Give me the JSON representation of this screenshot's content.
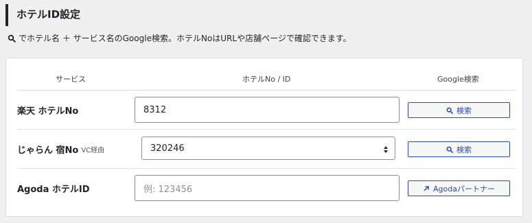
{
  "section": {
    "title": "ホテルID設定"
  },
  "hint": {
    "icon": "search-icon",
    "text": "でホテル名 ＋ サービス名のGoogle検索。ホテルNoはURLや店舗ページで確認できます。"
  },
  "table": {
    "headers": {
      "service": "サービス",
      "hotel_id": "ホテルNo / ID",
      "google": "Google検索"
    },
    "rows": [
      {
        "label": "楽天 ホテルNo",
        "sub": "",
        "value": "8312",
        "placeholder": "",
        "button_label": "検索",
        "button_icon": "search-icon"
      },
      {
        "label": "じゃらん 宿No",
        "sub": "VC経由",
        "value": "320246",
        "placeholder": "",
        "button_label": "検索",
        "button_icon": "search-icon"
      },
      {
        "label": "Agoda ホテルID",
        "sub": "",
        "value": "",
        "placeholder": "例: 123456",
        "button_label": "Agodaパートナー",
        "button_icon": "external-arrow-icon"
      }
    ]
  },
  "colors": {
    "highlight": "#d63b15",
    "button_border": "#2d49b8",
    "title_bar": "#1d2327"
  }
}
